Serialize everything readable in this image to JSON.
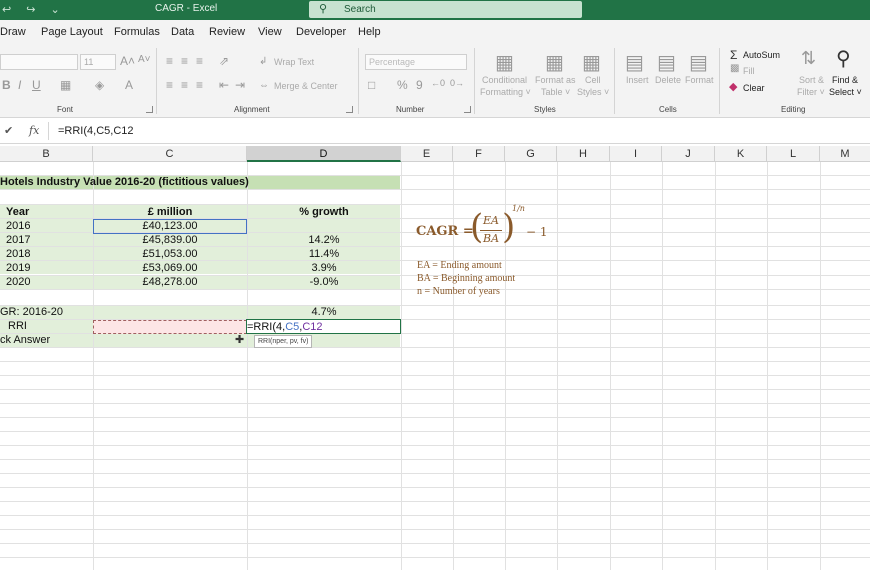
{
  "window": {
    "quick_access": "↩ ↪ ⌄",
    "title": "CAGR  -  Excel",
    "search_placeholder": "Search"
  },
  "ribbon_tabs": [
    "Draw",
    "Page Layout",
    "Formulas",
    "Data",
    "Review",
    "View",
    "Developer",
    "Help"
  ],
  "ribbon": {
    "font": {
      "label": "Font",
      "size": "11",
      "grow": "A˄",
      "shrink": "A˅",
      "bold": "B",
      "italic": "I",
      "underline": "U"
    },
    "alignment": {
      "label": "Alignment",
      "wrap_text": "Wrap Text",
      "merge_center": "Merge & Center"
    },
    "number": {
      "label": "Number",
      "format": "Percentage",
      "percent": "%",
      "comma": "9"
    },
    "styles": {
      "label": "Styles",
      "conditional": [
        "Conditional",
        "Formatting ˅"
      ],
      "format_as": [
        "Format as",
        "Table ˅"
      ],
      "cell_styles": [
        "Cell",
        "Styles ˅"
      ]
    },
    "cells": {
      "label": "Cells",
      "insert": "Insert",
      "delete": "Delete",
      "format": "Format"
    },
    "editing": {
      "label": "Editing",
      "autosum": "AutoSum",
      "fill": "Fill",
      "clear": "Clear",
      "sort_filter": [
        "Sort &",
        "Filter ˅"
      ],
      "find_select": [
        "Find &",
        "Select ˅"
      ]
    }
  },
  "formula_bar": {
    "confirm": "✔",
    "fx": "fx",
    "content": "=RRI(4,C5,C12"
  },
  "columns": [
    "B",
    "C",
    "D",
    "E",
    "F",
    "G",
    "H",
    "I",
    "J",
    "K",
    "L",
    "M"
  ],
  "sheet": {
    "title": "Hotels Industry Value 2016-20 (fictitious values)",
    "headers": {
      "year": "Year",
      "value": "£ million",
      "growth": "% growth"
    },
    "rows": [
      {
        "year": "2016",
        "value": "£40,123.00",
        "growth": ""
      },
      {
        "year": "2017",
        "value": "£45,839.00",
        "growth": "14.2%"
      },
      {
        "year": "2018",
        "value": "£51,053.00",
        "growth": "11.4%"
      },
      {
        "year": "2019",
        "value": "£53,069.00",
        "growth": "3.9%"
      },
      {
        "year": "2020",
        "value": "£48,278.00",
        "growth": "-9.0%"
      }
    ],
    "cagr_label": "GR: 2016-20",
    "cagr_value": "4.7%",
    "rri_label": "RRI",
    "check_label": "ck Answer",
    "editing_formula": {
      "prefix": "=RRI(4,",
      "ref1": "C5",
      "comma": ",",
      "ref2": "C12"
    },
    "tooltip": "RRI(nper, pv, fv)"
  },
  "formula_note": {
    "lhs": "CAGR =",
    "num": "EA",
    "den": "BA",
    "exp": "1/n",
    "tail": "− 1",
    "definitions": [
      "EA = Ending amount",
      "BA = Beginning amount",
      "n = Number of years"
    ]
  },
  "colors": {
    "excel_green": "#217346",
    "band_green": "#e2efda",
    "header_green": "#c6e0b4",
    "ref_blue": "#4472c4",
    "ref_purple": "#7030a0",
    "formula_brown": "#8a5a2b"
  }
}
